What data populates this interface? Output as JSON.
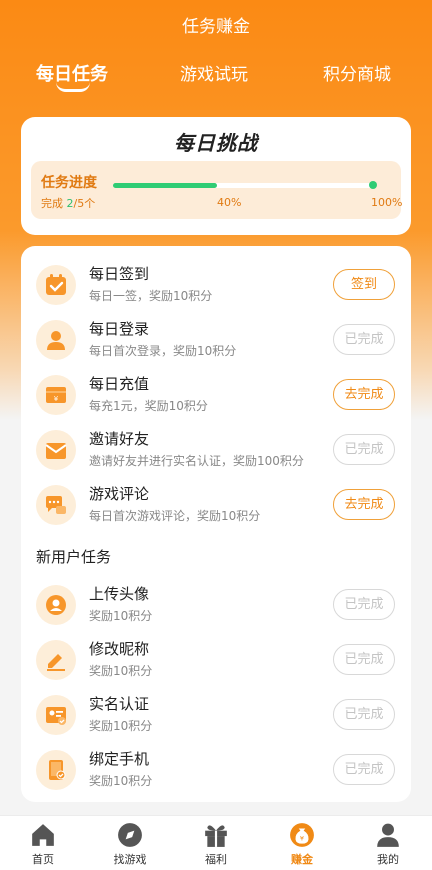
{
  "header": {
    "title": "任务赚金"
  },
  "tabs": [
    {
      "label": "每日任务",
      "active": true
    },
    {
      "label": "游戏试玩",
      "active": false
    },
    {
      "label": "积分商城",
      "active": false
    }
  ],
  "challenge": {
    "title": "每日挑战",
    "progress_label": "任务进度",
    "completed_prefix": "完成 ",
    "completed_count": "2",
    "completed_suffix": "/5个",
    "progress_fraction": 0.4,
    "mid_label": "40%",
    "end_label": "100%"
  },
  "daily_tasks": [
    {
      "title": "每日签到",
      "desc": "每日一签，奖励10积分",
      "button": "签到",
      "done": false,
      "icon": "calendar-check-icon"
    },
    {
      "title": "每日登录",
      "desc": "每日首次登录，奖励10积分",
      "button": "已完成",
      "done": true,
      "icon": "user-icon"
    },
    {
      "title": "每日充值",
      "desc": "每充1元，奖励10积分",
      "button": "去完成",
      "done": false,
      "icon": "wallet-icon"
    },
    {
      "title": "邀请好友",
      "desc": "邀请好友并进行实名认证，奖励100积分",
      "button": "已完成",
      "done": true,
      "icon": "envelope-icon"
    },
    {
      "title": "游戏评论",
      "desc": "每日首次游戏评论，奖励10积分",
      "button": "去完成",
      "done": false,
      "icon": "chat-icon"
    }
  ],
  "new_user_section": {
    "title": "新用户任务"
  },
  "new_user_tasks": [
    {
      "title": "上传头像",
      "desc": "奖励10积分",
      "button": "已完成",
      "done": true,
      "icon": "avatar-icon"
    },
    {
      "title": "修改昵称",
      "desc": "奖励10积分",
      "button": "已完成",
      "done": true,
      "icon": "pencil-icon"
    },
    {
      "title": "实名认证",
      "desc": "奖励10积分",
      "button": "已完成",
      "done": true,
      "icon": "id-card-icon"
    },
    {
      "title": "绑定手机",
      "desc": "奖励10积分",
      "button": "已完成",
      "done": true,
      "icon": "phone-icon"
    }
  ],
  "bottom_nav": [
    {
      "label": "首页",
      "icon": "home-icon",
      "active": false
    },
    {
      "label": "找游戏",
      "icon": "compass-icon",
      "active": false
    },
    {
      "label": "福利",
      "icon": "gift-icon",
      "active": false
    },
    {
      "label": "赚金",
      "icon": "coin-bag-icon",
      "active": true
    },
    {
      "label": "我的",
      "icon": "profile-icon",
      "active": false
    }
  ],
  "colors": {
    "primary": "#fb8a14",
    "accent": "#f08a16",
    "progress": "#2fcc74"
  }
}
